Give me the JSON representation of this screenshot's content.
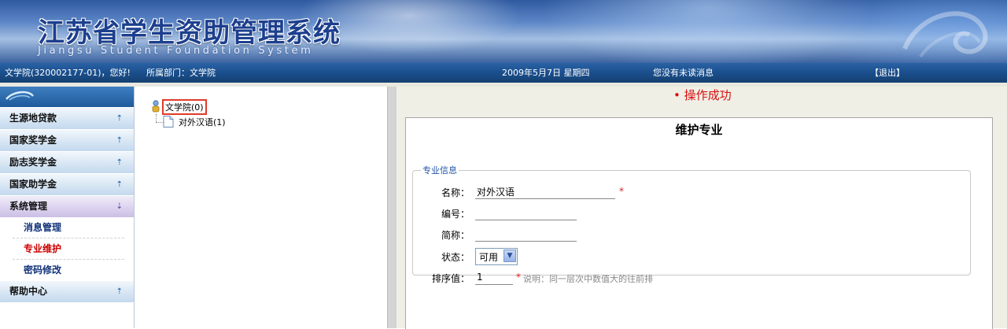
{
  "header": {
    "title": "江苏省学生资助管理系统",
    "subtitle": "Jiangsu Student Foundation System"
  },
  "statusbar": {
    "user": "文学院(320002177-01)，您好!",
    "department": "所属部门：文学院",
    "date": "2009年5月7日 星期四",
    "messages": "您没有未读消息",
    "logout": "【退出】"
  },
  "sidebar": {
    "items": [
      {
        "label": "生源地贷款",
        "icon": "chevron-up-icon"
      },
      {
        "label": "国家奖学金",
        "icon": "chevron-up-icon"
      },
      {
        "label": "励志奖学金",
        "icon": "chevron-up-icon"
      },
      {
        "label": "国家助学金",
        "icon": "chevron-up-icon"
      },
      {
        "label": "系统管理",
        "icon": "chevron-down-icon",
        "expanded": true
      }
    ],
    "subitems": [
      {
        "label": "消息管理"
      },
      {
        "label": "专业维护",
        "current": true
      },
      {
        "label": "密码修改"
      }
    ],
    "last_item": {
      "label": "帮助中心",
      "icon": "chevron-up-icon"
    }
  },
  "tree": {
    "root": "文学院(0)",
    "children": [
      {
        "label": "对外汉语(1)"
      }
    ]
  },
  "main": {
    "message": "• 操作成功",
    "form_title": "维护专业",
    "section_legend": "专业信息",
    "fields": {
      "name": {
        "label": "名称：",
        "value": "对外汉语",
        "required_mark": "*"
      },
      "code": {
        "label": "编号：",
        "value": ""
      },
      "short": {
        "label": "简称：",
        "value": ""
      },
      "status": {
        "label": "状态：",
        "value": "可用"
      },
      "order": {
        "label": "排序值：",
        "value": "1",
        "required_mark": "*",
        "note": "说明：同一层次中数值大的往前排"
      }
    }
  },
  "colors": {
    "statusbar": "#1a4f8d",
    "message_red": "#d81010",
    "current_item_red": "#cc0000",
    "legend_blue": "#2255a4"
  }
}
